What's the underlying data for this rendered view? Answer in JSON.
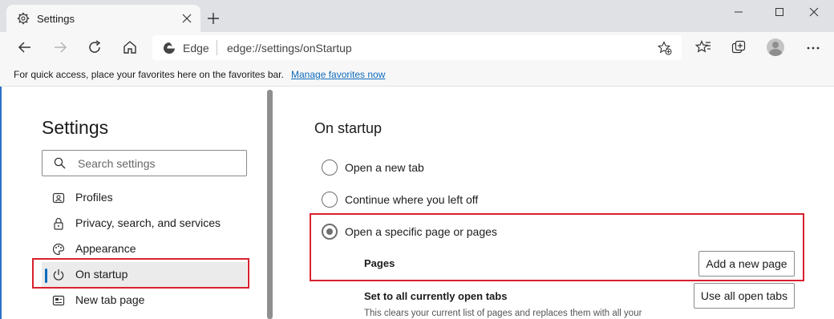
{
  "tab": {
    "title": "Settings",
    "icon": "gear-icon"
  },
  "address_bar": {
    "brand": "Edge",
    "url": "edge://settings/onStartup"
  },
  "favorites_bar": {
    "message": "For quick access, place your favorites here on the favorites bar.",
    "link": "Manage favorites now"
  },
  "sidebar": {
    "title": "Settings",
    "search_placeholder": "Search settings",
    "items": [
      {
        "label": "Profiles",
        "icon": "profile-icon"
      },
      {
        "label": "Privacy, search, and services",
        "icon": "lock-icon"
      },
      {
        "label": "Appearance",
        "icon": "palette-icon"
      },
      {
        "label": "On startup",
        "icon": "power-icon",
        "active": true
      },
      {
        "label": "New tab page",
        "icon": "new-tab-page-icon"
      }
    ]
  },
  "main": {
    "title": "On startup",
    "options": [
      {
        "label": "Open a new tab",
        "selected": false
      },
      {
        "label": "Continue where you left off",
        "selected": false
      },
      {
        "label": "Open a specific page or pages",
        "selected": true
      }
    ],
    "pages_label": "Pages",
    "add_page_button": "Add a new page",
    "open_tabs_label": "Set to all currently open tabs",
    "open_tabs_button": "Use all open tabs",
    "open_tabs_description": "This clears your current list of pages and replaces them with all your"
  },
  "colors": {
    "highlight_box": "#d9212e",
    "link": "#0f6cbd",
    "active_indicator": "#0f6cbd"
  }
}
